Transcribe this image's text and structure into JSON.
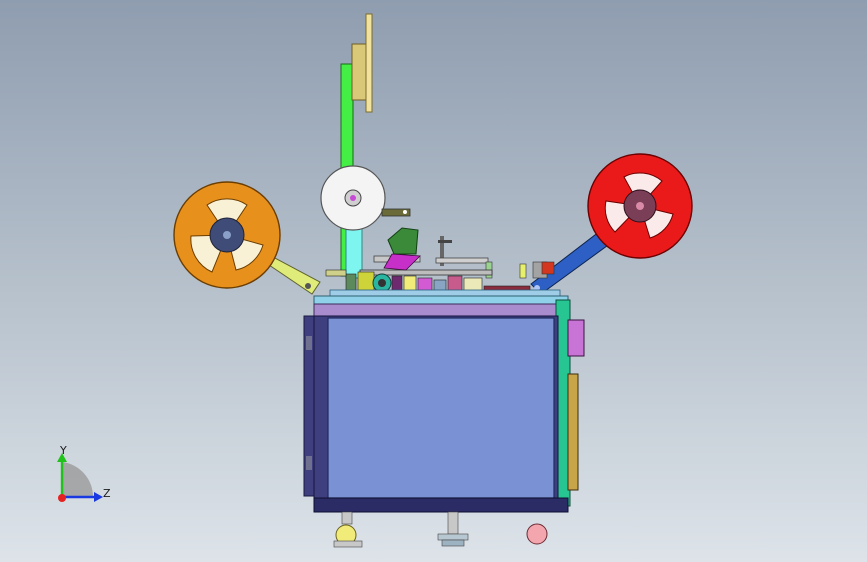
{
  "viewport": {
    "background_top": "#8f9db0",
    "background_bottom": "#dde3e9"
  },
  "model": {
    "reel_left_color": "#e8901c",
    "reel_right_color": "#ea1a1a",
    "reel_center_color": "#f4f4f4",
    "cabinet_front_color": "#7a92d4",
    "cabinet_frame_color": "#3f3f80",
    "top_rail_color": "#a98ccd",
    "arm_left_color": "#e0ec7a",
    "arm_right_color": "#2d5fc4",
    "mast_color": "#44ee44",
    "plate_color": "#ecd98a"
  },
  "triad": {
    "y_label": "Y",
    "z_label": "Z",
    "y_color": "#21c21b",
    "z_color": "#1838e2",
    "x_color": "#e52222"
  }
}
